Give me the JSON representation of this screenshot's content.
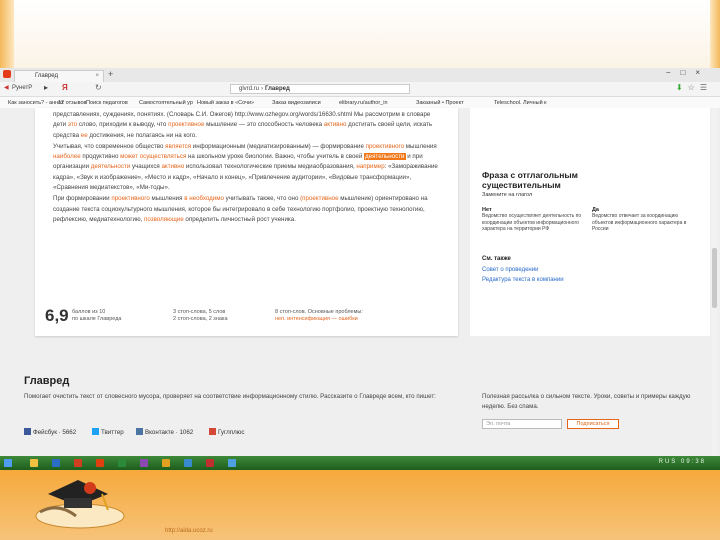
{
  "browser": {
    "tab_title": "Главред",
    "back_label": "РунетР",
    "url_host": "glvrd.ru",
    "url_title": "Главред"
  },
  "bookmarks": [
    "Как заносить? - аннот",
    "12 отзывов",
    "Поиск педагогов",
    "Самостоятельный ур",
    "Новый заказ в «Сочи»",
    "Заказ видеозаписи",
    "elibrary.ru/author_in",
    "Заказный • Проект",
    "Teleschool. Личный к"
  ],
  "card": {
    "paragraphs": [
      [
        {
          "t": "представлениях, суждениях, понятиях. (Словарь С.И. Ожегов) http://www.ozhegov.org/words/16630.shtml Мы рассмотрим в словаре дети "
        },
        {
          "t": "это",
          "hl": 1
        },
        {
          "t": " слово, приходим к выводу, что "
        },
        {
          "t": "проективное",
          "hl": 1
        },
        {
          "t": " мышление — это способность человека "
        },
        {
          "t": "активно",
          "hl": 1
        },
        {
          "t": " достигать своей цели, искать средства "
        },
        {
          "t": "ее",
          "hl": 1
        },
        {
          "t": " достижения, не полагаясь ни на кого."
        }
      ],
      [
        {
          "t": "Учитывая, что современное общество "
        },
        {
          "t": "является",
          "hl": 1
        },
        {
          "t": " информационным (медиатизированным) — формирование "
        },
        {
          "t": "проективного",
          "hl": 1
        },
        {
          "t": " мышления "
        },
        {
          "t": "наиболее",
          "hl": 1
        },
        {
          "t": " продуктивно "
        },
        {
          "t": "может осуществляться",
          "hl": 1
        },
        {
          "t": " на школьном уроке биологии. Важно, чтобы учитель в своей "
        },
        {
          "t": "деятельности",
          "hl": 2
        },
        {
          "t": " и при организации "
        },
        {
          "t": "деятельности",
          "hl": 1
        },
        {
          "t": " учащихся "
        },
        {
          "t": "активно",
          "hl": 1
        },
        {
          "t": " использовал технологические приемы медиаобразования, "
        },
        {
          "t": "например",
          "hl": 1
        },
        {
          "t": ": «Замораживание кадра», «Звук и изображение», «Место и кадр», «Начало и конец», «Привлечение аудитории», «Видовые трансформации», «Сравнения медиатекстов», «Ми-тоды»."
        }
      ],
      [
        {
          "t": "При формировании "
        },
        {
          "t": "проективного",
          "hl": 1
        },
        {
          "t": " мышления "
        },
        {
          "t": "в",
          "hl": 1
        },
        {
          "t": " "
        },
        {
          "t": "необходимо",
          "hl": 1
        },
        {
          "t": " учитывать также, что оно "
        },
        {
          "t": "(проективное",
          "hl": 1
        },
        {
          "t": " мышление) ориентировано на создание текста социокультурного мышления, которое бы интегрировало в себе технологию портфолио, проектную технологию, рефлексию, медиатехнологию, "
        },
        {
          "t": "позволяющие",
          "hl": 1
        },
        {
          "t": " определить личностный рост ученика."
        }
      ]
    ],
    "score": "6,9",
    "score_notes": [
      {
        "lines": [
          "баллов из 10",
          "по шкале Главреда"
        ]
      },
      {
        "lines": [
          "3 стоп-слова, 5 слов",
          "2 стоп-слова, 2 знака"
        ]
      },
      {
        "lines": [
          "8 стоп-слов. Основные проблемы:",
          "неп. интенсификация — ошибки"
        ]
      }
    ]
  },
  "sidebar": {
    "title": "Фраза с отглагольным существительным",
    "subtitle": "Замените на глагол",
    "cols": [
      {
        "head": "Нет",
        "body": "Ведомство осуществляет деятельность по координации объектов информационного характера на территории РФ"
      },
      {
        "head": "Да",
        "body": "Ведомство отвечает за координацию объектов информационного характера в России"
      }
    ],
    "see_also": "См. также",
    "links": [
      "Совет о проведении",
      "Редактура текста в компании"
    ]
  },
  "footer": {
    "title": "Главред",
    "description": "Помогает очистить текст от словесного мусора, проверяет на соответствие информационному стилю. Рассказите о Главреде всем, кто пишет:",
    "social": [
      {
        "label": "Фейсбук · 5662",
        "color": "#3b5998"
      },
      {
        "label": "Твиттер",
        "color": "#1da1f2"
      },
      {
        "label": "Вконтакте · 1062",
        "color": "#4c75a3"
      },
      {
        "label": "Гуглплюс",
        "color": "#d34836"
      }
    ],
    "newsletter": "Полезная рассылка о сильном тексте. Уроки, советы и примеры каждую неделю. Без спама.",
    "email_placeholder": "Эл. почта",
    "subscribe": "Подписаться"
  },
  "taskbar": {
    "lang": "RUS",
    "time": "09:38"
  },
  "slide_url": "http://aida.ucoz.ru",
  "colors": {
    "accent": "#e5651b",
    "highlight_box": "#f07818",
    "slide_frame": "#e9a232",
    "taskbar": "#2d722b"
  }
}
